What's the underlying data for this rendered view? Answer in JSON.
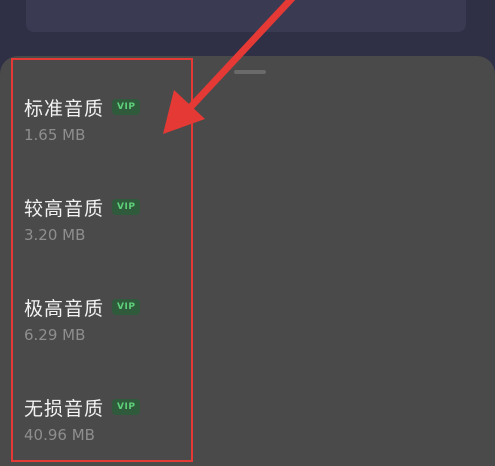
{
  "colors": {
    "background": "#2f2f46",
    "sheet": "#4a4a4a",
    "highlight": "#e53935",
    "vip_text": "#5fd07a",
    "vip_bg": "#2f5a3c"
  },
  "quality_options": [
    {
      "title": "标准音质",
      "badge": "VIP",
      "size": "1.65 MB"
    },
    {
      "title": "较高音质",
      "badge": "VIP",
      "size": "3.20 MB"
    },
    {
      "title": "极高音质",
      "badge": "VIP",
      "size": "6.29 MB"
    },
    {
      "title": "无损音质",
      "badge": "VIP",
      "size": "40.96 MB"
    }
  ],
  "annotation": {
    "arrow_icon": "red-arrow-icon"
  }
}
